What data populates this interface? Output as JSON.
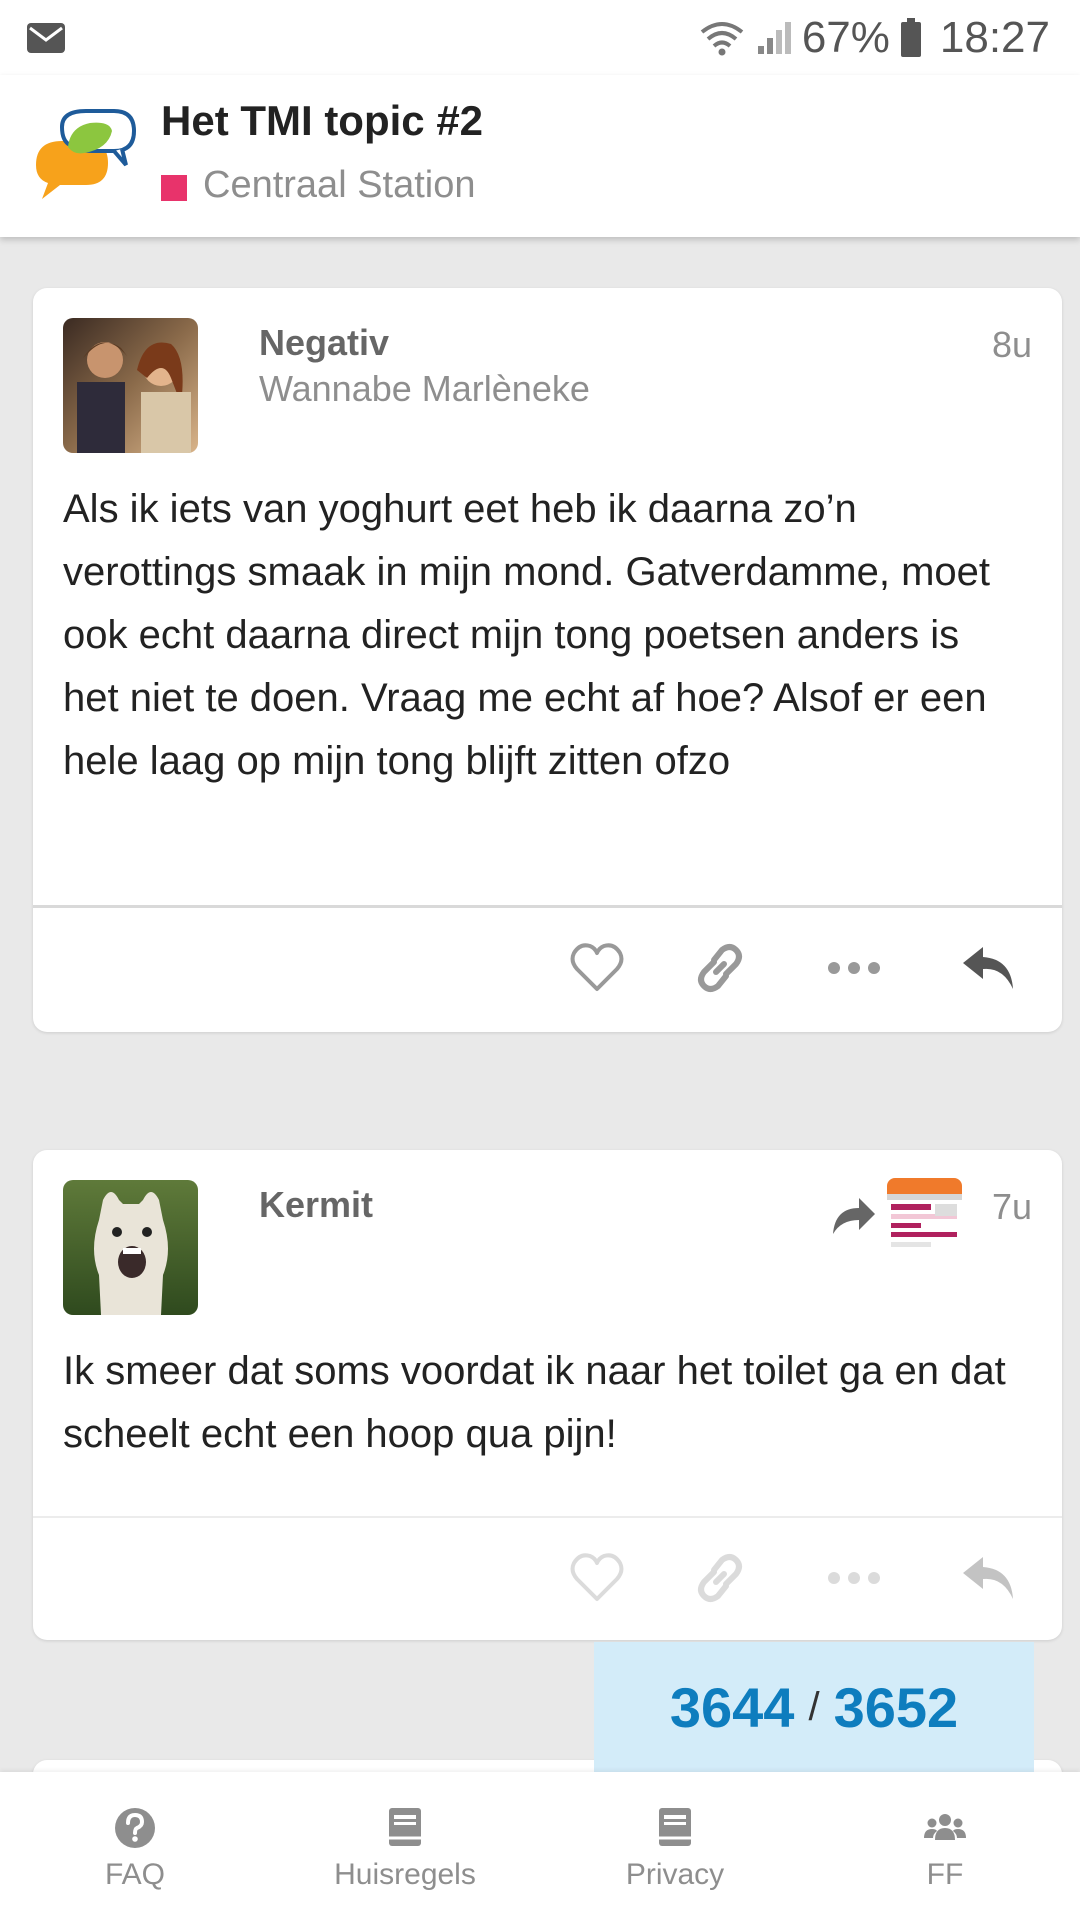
{
  "status_bar": {
    "battery_percent": "67%",
    "time": "18:27",
    "icons": [
      "mail-icon",
      "wifi-icon",
      "signal-icon",
      "battery-icon"
    ]
  },
  "header": {
    "title": "Het TMI topic #2",
    "category": "Centraal Station",
    "category_color": "#e8336b"
  },
  "posts": [
    {
      "username": "Negativ",
      "user_title": "Wannabe Marlèneke",
      "time": "8u",
      "body": "Als ik iets van yoghurt eet heb ik daarna zo’n verottings smaak in mijn mond. Gatverdamme, moet ook echt daarna direct mijn tong poetsen anders is het niet te doen. Vraag me echt af hoe? Alsof er een hele laag op mijn tong blijft zitten ofzo"
    },
    {
      "username": "Kermit",
      "time": "7u",
      "body": "Ik smeer dat soms voordat ik naar het toilet ga en dat scheelt echt een hoop qua pijn!"
    }
  ],
  "progress": {
    "current": "3644",
    "separator": "/",
    "total": "3652"
  },
  "bottom_nav": {
    "items": [
      {
        "label": "FAQ",
        "icon": "question-icon"
      },
      {
        "label": "Huisregels",
        "icon": "book-icon"
      },
      {
        "label": "Privacy",
        "icon": "book-icon"
      },
      {
        "label": "FF",
        "icon": "users-icon"
      }
    ]
  },
  "colors": {
    "accent": "#0e7dbe",
    "progress_bg": "#d3ecf9",
    "page_bg": "#e9e9e9"
  }
}
